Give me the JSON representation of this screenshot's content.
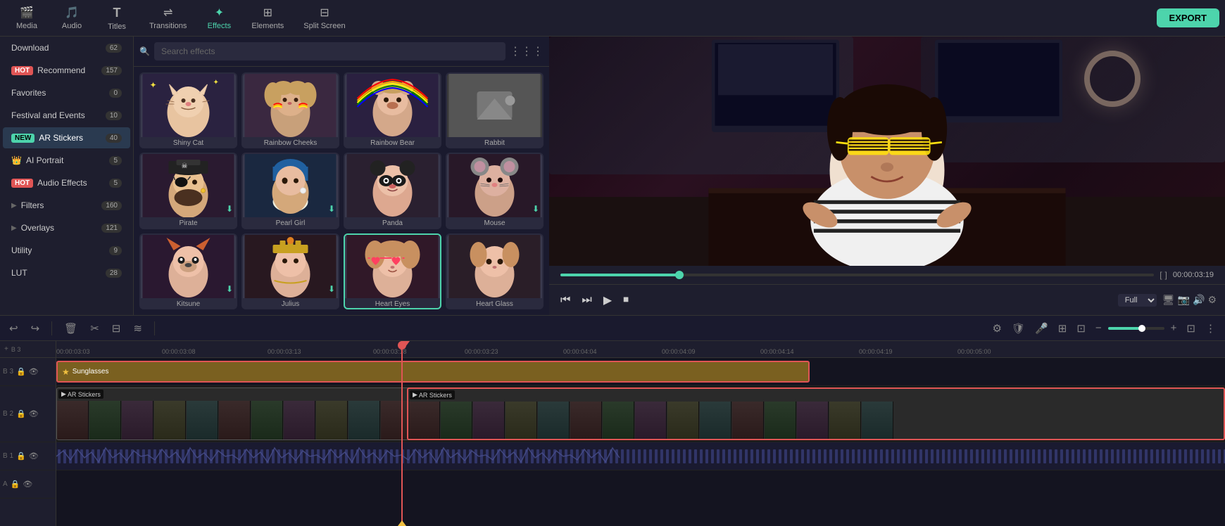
{
  "toolbar": {
    "items": [
      {
        "id": "media",
        "label": "Media",
        "icon": "🎬",
        "active": false
      },
      {
        "id": "audio",
        "label": "Audio",
        "icon": "🎵",
        "active": false
      },
      {
        "id": "titles",
        "label": "Titles",
        "icon": "T",
        "active": false
      },
      {
        "id": "transitions",
        "label": "Transitions",
        "icon": "⇌",
        "active": false
      },
      {
        "id": "effects",
        "label": "Effects",
        "icon": "✦",
        "active": true
      },
      {
        "id": "elements",
        "label": "Elements",
        "icon": "⊞",
        "active": false
      },
      {
        "id": "splitscreen",
        "label": "Split Screen",
        "icon": "⊟",
        "active": false
      }
    ],
    "export_label": "EXPORT"
  },
  "sidebar": {
    "items": [
      {
        "id": "download",
        "label": "Download",
        "count": "62",
        "badge": null
      },
      {
        "id": "recommend",
        "label": "Recommend",
        "count": "157",
        "badge": "HOT"
      },
      {
        "id": "favorites",
        "label": "Favorites",
        "count": "0",
        "badge": null
      },
      {
        "id": "festival",
        "label": "Festival and Events",
        "count": "10",
        "badge": null
      },
      {
        "id": "ar-stickers",
        "label": "AR Stickers",
        "count": "40",
        "badge": "NEW"
      },
      {
        "id": "ai-portrait",
        "label": "AI Portrait",
        "count": "5",
        "badge": "CROWN"
      },
      {
        "id": "audio-effects",
        "label": "Audio Effects",
        "count": "5",
        "badge": "HOT"
      },
      {
        "id": "filters",
        "label": "Filters",
        "count": "160",
        "badge": null,
        "arrow": true
      },
      {
        "id": "overlays",
        "label": "Overlays",
        "count": "121",
        "badge": null,
        "arrow": true
      },
      {
        "id": "utility",
        "label": "Utility",
        "count": "9",
        "badge": null
      },
      {
        "id": "lut",
        "label": "LUT",
        "count": "28",
        "badge": null
      }
    ]
  },
  "effects_panel": {
    "search_placeholder": "Search effects",
    "items": [
      {
        "id": "shiny-cat",
        "label": "Shiny Cat",
        "row": 1,
        "col": 1,
        "has_download": false,
        "selected": false
      },
      {
        "id": "rainbow-cheeks",
        "label": "Rainbow Cheeks",
        "row": 1,
        "col": 2,
        "has_download": false,
        "selected": false
      },
      {
        "id": "rainbow-bear",
        "label": "Rainbow Bear",
        "row": 1,
        "col": 3,
        "has_download": false,
        "selected": false
      },
      {
        "id": "rabbit",
        "label": "Rabbit",
        "row": 1,
        "col": 4,
        "has_download": false,
        "selected": false
      },
      {
        "id": "pirate",
        "label": "Pirate",
        "row": 2,
        "col": 1,
        "has_download": true,
        "selected": false
      },
      {
        "id": "pearl-girl",
        "label": "Pearl Girl",
        "row": 2,
        "col": 2,
        "has_download": true,
        "selected": false
      },
      {
        "id": "panda",
        "label": "Panda",
        "row": 2,
        "col": 3,
        "has_download": false,
        "selected": false
      },
      {
        "id": "mouse",
        "label": "Mouse",
        "row": 2,
        "col": 4,
        "has_download": true,
        "selected": false
      },
      {
        "id": "effect-3-1",
        "label": "Kitsune",
        "row": 3,
        "col": 1,
        "has_download": true,
        "selected": false
      },
      {
        "id": "effect-3-2",
        "label": "Julius",
        "row": 3,
        "col": 2,
        "has_download": true,
        "selected": false
      },
      {
        "id": "heart-eyes",
        "label": "Heart Eyes",
        "row": 3,
        "col": 3,
        "has_download": false,
        "selected": true
      },
      {
        "id": "effect-3-4",
        "label": "Heart Glass",
        "row": 3,
        "col": 4,
        "has_download": false,
        "selected": false
      }
    ]
  },
  "preview": {
    "time_current": "00:00:03:19",
    "progress_percent": 20,
    "zoom_level": "Full",
    "controls": {
      "rewind": "⏮",
      "step_back": "⏭",
      "play": "▶",
      "stop": "⏹"
    }
  },
  "timeline": {
    "toolbar_buttons": [
      "undo",
      "redo",
      "delete",
      "cut",
      "audio_detach",
      "stabilize"
    ],
    "time_markers": [
      "00:00:03:03",
      "00:00:03:08",
      "00:00:03:13",
      "00:00:03:18",
      "00:00:03:23",
      "00:00:04:04",
      "00:00:04:09",
      "00:00:04:14",
      "00:00:04:19",
      "00:00:05:00",
      "00:00:05:0"
    ],
    "tracks": [
      {
        "num": "3",
        "type": "label",
        "clip": "Sunglasses",
        "clip_type": "golden"
      },
      {
        "num": "2",
        "type": "ar-stickers",
        "clip": "AR Stickers"
      },
      {
        "num": "1",
        "type": "video"
      },
      {
        "num": "",
        "type": "audio"
      }
    ],
    "playhead_position": "00:00:03:18"
  }
}
